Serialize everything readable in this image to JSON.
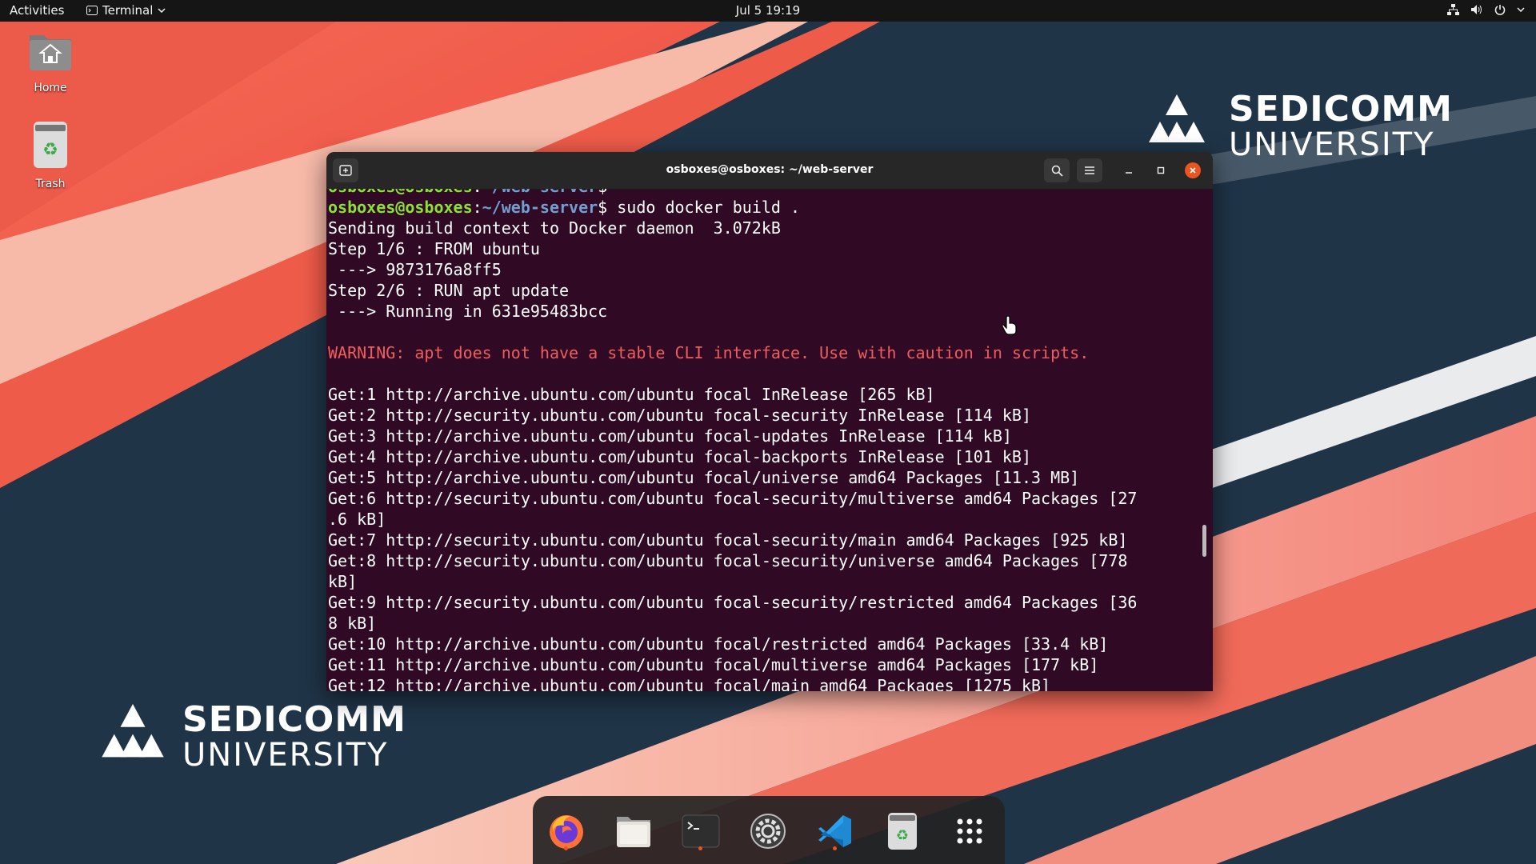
{
  "topbar": {
    "activities": "Activities",
    "app_menu": "Terminal",
    "clock": "Jul 5  19:19"
  },
  "desktop": {
    "icons": [
      {
        "label": "Home",
        "icon": "home-folder-icon"
      },
      {
        "label": "Trash",
        "icon": "trash-icon"
      }
    ]
  },
  "branding": {
    "name": "SEDICOMM",
    "sub": "UNIVERSITY"
  },
  "terminal": {
    "title": "osboxes@osboxes: ~/web-server",
    "prompt_user": "osboxes@osboxes",
    "prompt_sep": ":",
    "prompt_path": "~/web-server",
    "prompt_suffix": "$ ",
    "command": "sudo docker build .",
    "lines": [
      "Sending build context to Docker daemon  3.072kB",
      "Step 1/6 : FROM ubuntu",
      " ---> 9873176a8ff5",
      "Step 2/6 : RUN apt update",
      " ---> Running in 631e95483bcc",
      "",
      "WARNING: apt does not have a stable CLI interface. Use with caution in scripts.",
      "",
      "Get:1 http://archive.ubuntu.com/ubuntu focal InRelease [265 kB]",
      "Get:2 http://security.ubuntu.com/ubuntu focal-security InRelease [114 kB]",
      "Get:3 http://archive.ubuntu.com/ubuntu focal-updates InRelease [114 kB]",
      "Get:4 http://archive.ubuntu.com/ubuntu focal-backports InRelease [101 kB]",
      "Get:5 http://archive.ubuntu.com/ubuntu focal/universe amd64 Packages [11.3 MB]",
      "Get:6 http://security.ubuntu.com/ubuntu focal-security/multiverse amd64 Packages [27",
      ".6 kB]",
      "Get:7 http://security.ubuntu.com/ubuntu focal-security/main amd64 Packages [925 kB]",
      "Get:8 http://security.ubuntu.com/ubuntu focal-security/universe amd64 Packages [778",
      "kB]",
      "Get:9 http://security.ubuntu.com/ubuntu focal-security/restricted amd64 Packages [36",
      "8 kB]",
      "Get:10 http://archive.ubuntu.com/ubuntu focal/restricted amd64 Packages [33.4 kB]",
      "Get:11 http://archive.ubuntu.com/ubuntu focal/multiverse amd64 Packages [177 kB]",
      "Get:12 http://archive.ubuntu.com/ubuntu focal/main amd64 Packages [1275 kB]"
    ],
    "warning_index": 6
  },
  "dock": {
    "items": [
      "firefox-icon",
      "files-icon",
      "terminal-icon",
      "settings-icon",
      "vscode-icon",
      "trash-icon",
      "app-grid-icon"
    ],
    "running": [
      0,
      2,
      4
    ]
  },
  "colors": {
    "terminal_bg": "#300a24",
    "prompt_user": "#8ae234",
    "prompt_path": "#729fcf",
    "warning": "#ef5d5d",
    "accent": "#e95420",
    "close_button": "#e95420"
  }
}
